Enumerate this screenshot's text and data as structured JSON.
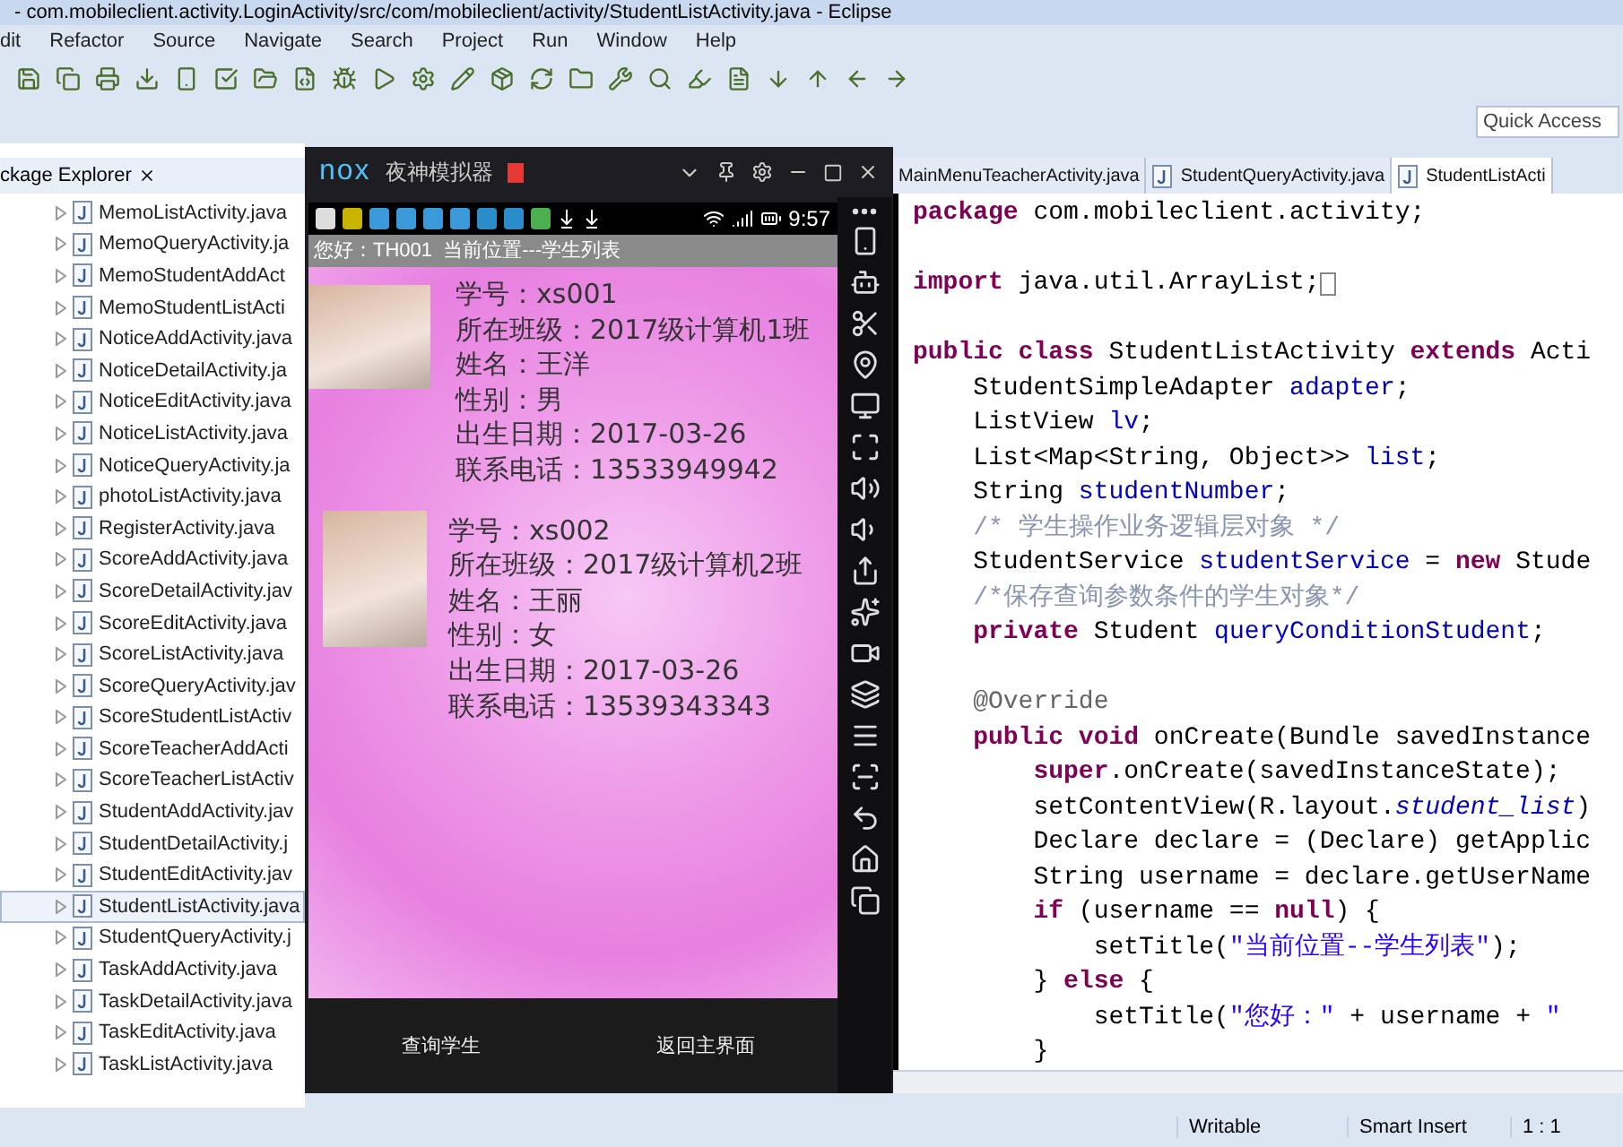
{
  "window": {
    "title": "- com.mobileclient.activity.LoginActivity/src/com/mobileclient/activity/StudentListActivity.java - Eclipse"
  },
  "menu": [
    "dit",
    "Refactor",
    "Source",
    "Navigate",
    "Search",
    "Project",
    "Run",
    "Window",
    "Help"
  ],
  "quick_access": {
    "placeholder": "Quick Access"
  },
  "package_explorer": {
    "title": "ckage Explorer",
    "items": [
      {
        "name": "MemoListActivity.java",
        "selected": false
      },
      {
        "name": "MemoQueryActivity.ja",
        "selected": false
      },
      {
        "name": "MemoStudentAddAct",
        "selected": false
      },
      {
        "name": "MemoStudentListActi",
        "selected": false
      },
      {
        "name": "NoticeAddActivity.java",
        "selected": false
      },
      {
        "name": "NoticeDetailActivity.ja",
        "selected": false
      },
      {
        "name": "NoticeEditActivity.java",
        "selected": false
      },
      {
        "name": "NoticeListActivity.java",
        "selected": false
      },
      {
        "name": "NoticeQueryActivity.ja",
        "selected": false
      },
      {
        "name": "photoListActivity.java",
        "selected": false
      },
      {
        "name": "RegisterActivity.java",
        "selected": false
      },
      {
        "name": "ScoreAddActivity.java",
        "selected": false
      },
      {
        "name": "ScoreDetailActivity.jav",
        "selected": false
      },
      {
        "name": "ScoreEditActivity.java",
        "selected": false
      },
      {
        "name": "ScoreListActivity.java",
        "selected": false
      },
      {
        "name": "ScoreQueryActivity.jav",
        "selected": false
      },
      {
        "name": "ScoreStudentListActiv",
        "selected": false
      },
      {
        "name": "ScoreTeacherAddActi",
        "selected": false
      },
      {
        "name": "ScoreTeacherListActiv",
        "selected": false
      },
      {
        "name": "StudentAddActivity.jav",
        "selected": false
      },
      {
        "name": "StudentDetailActivity.j",
        "selected": false
      },
      {
        "name": "StudentEditActivity.jav",
        "selected": false
      },
      {
        "name": "StudentListActivity.java",
        "selected": true
      },
      {
        "name": "StudentQueryActivity.j",
        "selected": false
      },
      {
        "name": "TaskAddActivity.java",
        "selected": false
      },
      {
        "name": "TaskDetailActivity.java",
        "selected": false
      },
      {
        "name": "TaskEditActivity.java",
        "selected": false
      },
      {
        "name": "TaskListActivity.java",
        "selected": false
      }
    ]
  },
  "emulator": {
    "logo": "nox",
    "title": "夜神模拟器",
    "time": "9:57",
    "app_title": "您好：TH001  当前位置---学生列表",
    "students": [
      {
        "fields": [
          "学号：xs001",
          "所在班级：2017级计算机1班",
          "姓名：王洋",
          "性别：男",
          "出生日期：2017-03-26",
          "联系电话：13533949942"
        ]
      },
      {
        "fields": [
          "学号：xs002",
          "所在班级：2017级计算机2班",
          "姓名：王丽",
          "性别：女",
          "出生日期：2017-03-26",
          "联系电话：13539343343"
        ]
      }
    ],
    "buttons": [
      "查询学生",
      "返回主界面"
    ]
  },
  "editor_tabs": [
    {
      "label": "MainMenuTeacherActivity.java",
      "selected": false
    },
    {
      "label": "StudentQueryActivity.java",
      "selected": false
    },
    {
      "label": "StudentListActi",
      "selected": true
    }
  ],
  "code": [
    {
      "segments": [
        {
          "kind": "kw",
          "text": "package"
        },
        {
          "kind": "plain",
          "text": " com.mobileclient.activity;"
        }
      ]
    },
    {
      "blank_before": true,
      "folded": true,
      "segments": [
        {
          "kind": "kw",
          "text": "import"
        },
        {
          "kind": "plain",
          "text": " java.util.ArrayList;"
        }
      ]
    },
    {
      "blank_before": true,
      "segments": [
        {
          "kind": "kw",
          "text": "public class"
        },
        {
          "kind": "plain",
          "text": " StudentListActivity "
        },
        {
          "kind": "kw",
          "text": "extends"
        },
        {
          "kind": "plain",
          "text": " Acti"
        }
      ]
    },
    {
      "segments": [
        {
          "kind": "plain",
          "text": "    StudentSimpleAdapter "
        },
        {
          "kind": "field",
          "text": "adapter"
        },
        {
          "kind": "plain",
          "text": ";"
        }
      ]
    },
    {
      "segments": [
        {
          "kind": "plain",
          "text": "    ListView "
        },
        {
          "kind": "field",
          "text": "lv"
        },
        {
          "kind": "plain",
          "text": ";"
        }
      ]
    },
    {
      "segments": [
        {
          "kind": "plain",
          "text": "    List<Map<String, Object>> "
        },
        {
          "kind": "field",
          "text": "list"
        },
        {
          "kind": "plain",
          "text": ";"
        }
      ]
    },
    {
      "segments": [
        {
          "kind": "plain",
          "text": "    String "
        },
        {
          "kind": "field",
          "text": "studentNumber"
        },
        {
          "kind": "plain",
          "text": ";"
        }
      ]
    },
    {
      "segments": [
        {
          "kind": "comment",
          "text": "    /* 学生操作业务逻辑层对象 */"
        }
      ]
    },
    {
      "segments": [
        {
          "kind": "plain",
          "text": "    StudentService "
        },
        {
          "kind": "field",
          "text": "studentService"
        },
        {
          "kind": "plain",
          "text": " = "
        },
        {
          "kind": "kw",
          "text": "new"
        },
        {
          "kind": "plain",
          "text": " Stude"
        }
      ]
    },
    {
      "segments": [
        {
          "kind": "comment",
          "text": "    /*保存查询参数条件的学生对象*/"
        }
      ]
    },
    {
      "segments": [
        {
          "kind": "kw",
          "text": "    private"
        },
        {
          "kind": "plain",
          "text": " Student "
        },
        {
          "kind": "field",
          "text": "queryConditionStudent"
        },
        {
          "kind": "plain",
          "text": ";"
        }
      ]
    },
    {
      "blank_before": true,
      "segments": [
        {
          "kind": "annotation",
          "text": "    @Override"
        }
      ]
    },
    {
      "segments": [
        {
          "kind": "kw",
          "text": "    public void"
        },
        {
          "kind": "plain",
          "text": " onCreate(Bundle savedInstance"
        }
      ]
    },
    {
      "segments": [
        {
          "kind": "kw",
          "text": "        super"
        },
        {
          "kind": "plain",
          "text": ".onCreate(savedInstanceState);"
        }
      ]
    },
    {
      "segments": [
        {
          "kind": "plain",
          "text": "        setContentView(R.layout."
        },
        {
          "kind": "static",
          "text": "student_list"
        },
        {
          "kind": "plain",
          "text": ")"
        }
      ]
    },
    {
      "segments": [
        {
          "kind": "plain",
          "text": "        Declare declare = (Declare) getApplic"
        }
      ]
    },
    {
      "segments": [
        {
          "kind": "plain",
          "text": "        String username = declare.getUserName"
        }
      ]
    },
    {
      "segments": [
        {
          "kind": "kw",
          "text": "        if"
        },
        {
          "kind": "plain",
          "text": " (username == "
        },
        {
          "kind": "kw",
          "text": "null"
        },
        {
          "kind": "plain",
          "text": ") {"
        }
      ]
    },
    {
      "segments": [
        {
          "kind": "plain",
          "text": "            setTitle("
        },
        {
          "kind": "string",
          "text": "\"当前位置--学生列表\""
        },
        {
          "kind": "plain",
          "text": ");"
        }
      ]
    },
    {
      "segments": [
        {
          "kind": "plain",
          "text": "        } "
        },
        {
          "kind": "kw",
          "text": "else"
        },
        {
          "kind": "plain",
          "text": " {"
        }
      ]
    },
    {
      "segments": [
        {
          "kind": "plain",
          "text": "            setTitle("
        },
        {
          "kind": "string",
          "text": "\"您好：\""
        },
        {
          "kind": "plain",
          "text": " + username + "
        },
        {
          "kind": "string",
          "text": "\""
        }
      ]
    },
    {
      "segments": [
        {
          "kind": "plain",
          "text": "        }"
        }
      ]
    }
  ],
  "status_bar": [
    "Writable",
    "Smart Insert",
    "1 : 1"
  ]
}
